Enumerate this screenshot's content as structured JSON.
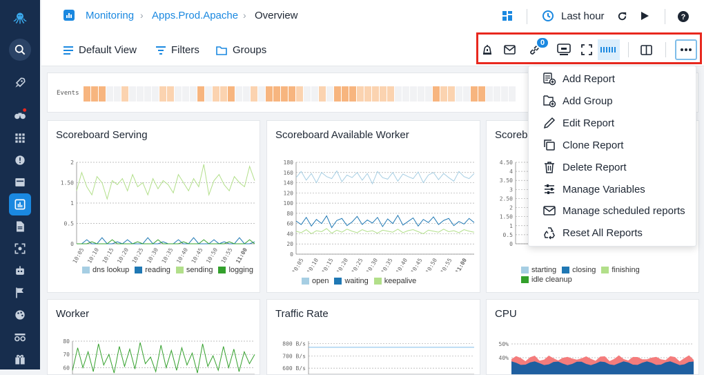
{
  "breadcrumb": {
    "items": [
      "Monitoring",
      "Apps.Prod.Apache",
      "Overview"
    ]
  },
  "time_range": {
    "label": "Last hour"
  },
  "toolbar": {
    "default_view": "Default View",
    "filters": "Filters",
    "groups": "Groups",
    "links_badge": "0"
  },
  "events": {
    "label": "Events"
  },
  "menu": {
    "items": [
      "Add Report",
      "Add Group",
      "Edit Report",
      "Clone Report",
      "Delete Report",
      "Manage Variables",
      "Manage scheduled reports",
      "Reset All Reports"
    ]
  },
  "panels": [
    {
      "title": "Scoreboard Serving",
      "legend": [
        {
          "name": "dns lookup",
          "color": "#a6cee3"
        },
        {
          "name": "reading",
          "color": "#1f78b4"
        },
        {
          "name": "sending",
          "color": "#b2df8a"
        },
        {
          "name": "logging",
          "color": "#33a02c"
        }
      ]
    },
    {
      "title": "Scoreboard Available Worker",
      "legend": [
        {
          "name": "open",
          "color": "#a6cee3"
        },
        {
          "name": "waiting",
          "color": "#1f78b4"
        },
        {
          "name": "keepalive",
          "color": "#b2df8a"
        }
      ]
    },
    {
      "title": "Scoreb",
      "legend": [
        {
          "name": "starting",
          "color": "#a6cee3"
        },
        {
          "name": "closing",
          "color": "#1f78b4"
        },
        {
          "name": "finishing",
          "color": "#b2df8a"
        },
        {
          "name": "idle cleanup",
          "color": "#33a02c"
        }
      ]
    },
    {
      "title": "Worker"
    },
    {
      "title": "Traffic Rate"
    },
    {
      "title": "CPU"
    }
  ],
  "chart_data": [
    {
      "type": "line",
      "title": "Scoreboard Serving",
      "x_ticks": [
        "10:05",
        "10:10",
        "10:15",
        "10:20",
        "10:25",
        "10:30",
        "10:35",
        "10:40",
        "10:45",
        "10:50",
        "10:55",
        "11:00"
      ],
      "y_ticks": [
        "0",
        "0.5",
        "1",
        "1.50",
        "2"
      ],
      "ylim": [
        0,
        2
      ],
      "series": [
        {
          "name": "sending",
          "values": [
            1.3,
            1.75,
            1.4,
            1.2,
            1.65,
            1.5,
            1.1,
            1.55,
            1.45,
            1.6,
            1.3,
            1.7,
            1.4,
            1.5,
            1.2,
            1.6,
            1.35,
            1.55,
            1.45,
            1.25,
            1.7,
            1.5,
            1.3,
            1.6,
            1.4,
            1.95,
            1.2,
            1.55,
            1.7,
            1.45,
            1.3,
            1.65,
            1.5,
            1.4,
            1.9,
            1.55
          ]
        },
        {
          "name": "reading",
          "values": [
            0,
            0,
            0.1,
            0,
            0,
            0.15,
            0,
            0,
            0.05,
            0,
            0.1,
            0,
            0,
            0,
            0.15,
            0,
            0,
            0.05,
            0,
            0,
            0.1,
            0,
            0,
            0.15,
            0,
            0,
            0,
            0.1,
            0,
            0.05,
            0,
            0,
            0.15,
            0,
            0,
            0.05
          ]
        },
        {
          "name": "logging",
          "values": [
            0,
            0,
            0,
            0.05,
            0,
            0,
            0,
            0.1,
            0,
            0,
            0,
            0,
            0.05,
            0,
            0,
            0,
            0.1,
            0,
            0,
            0,
            0,
            0.05,
            0,
            0,
            0,
            0.1,
            0,
            0,
            0,
            0,
            0.05,
            0,
            0,
            0,
            0.1,
            0
          ]
        }
      ]
    },
    {
      "type": "line",
      "title": "Scoreboard Available Worker",
      "x_ticks": [
        "10:05",
        "10:10",
        "10:15",
        "10:20",
        "10:25",
        "10:30",
        "10:35",
        "10:40",
        "10:45",
        "10:50",
        "10:55",
        "11:00"
      ],
      "y_ticks": [
        "0",
        "20",
        "40",
        "60",
        "80",
        "100",
        "120",
        "140",
        "160",
        "180"
      ],
      "ylim": [
        0,
        180
      ],
      "series": [
        {
          "name": "open",
          "values": [
            150,
            162,
            145,
            158,
            140,
            160,
            152,
            148,
            163,
            142,
            155,
            150,
            160,
            145,
            158,
            138,
            162,
            150,
            147,
            160,
            143,
            157,
            152,
            148,
            161,
            140,
            155,
            160,
            146,
            158,
            150,
            143,
            162,
            152,
            148,
            158
          ]
        },
        {
          "name": "waiting",
          "values": [
            65,
            58,
            72,
            55,
            68,
            60,
            75,
            52,
            66,
            70,
            56,
            63,
            74,
            58,
            67,
            61,
            72,
            54,
            69,
            60,
            76,
            57,
            64,
            71,
            55,
            68,
            62,
            73,
            58,
            66,
            70,
            56,
            64,
            59,
            70,
            62
          ]
        },
        {
          "name": "keepalive",
          "values": [
            45,
            42,
            48,
            40,
            46,
            44,
            50,
            41,
            47,
            43,
            49,
            45,
            42,
            48,
            44,
            46,
            41,
            47,
            45,
            43,
            49,
            42,
            46,
            48,
            44,
            40,
            47,
            45,
            43,
            49,
            44,
            46,
            42,
            48,
            45,
            43
          ]
        }
      ]
    },
    {
      "type": "line",
      "title": "Scoreb",
      "y_ticks": [
        "0",
        "0.5",
        "1",
        "1.50",
        "2",
        "2.50",
        "3",
        "3.50",
        "4",
        "4.50"
      ],
      "ylim": [
        0,
        4.5
      ]
    },
    {
      "type": "line",
      "title": "Worker",
      "y_ticks": [
        "60",
        "70",
        "80"
      ],
      "ylim": [
        55,
        80
      ],
      "series": [
        {
          "name": "worker",
          "values": [
            58,
            75,
            60,
            72,
            57,
            78,
            62,
            70,
            56,
            76,
            61,
            74,
            59,
            79,
            63,
            68,
            57,
            77,
            60,
            73,
            58,
            75,
            62,
            71,
            56,
            78,
            61,
            69,
            58,
            76,
            60,
            74,
            57,
            72,
            63,
            70
          ]
        }
      ]
    },
    {
      "type": "line",
      "title": "Traffic Rate",
      "y_ticks": [
        "600 B/s",
        "700 B/s",
        "800 B/s"
      ],
      "ylim": [
        550,
        820
      ],
      "series": [
        {
          "name": "traffic",
          "values": [
            770,
            770,
            770,
            770,
            770,
            770,
            770,
            770,
            770,
            770,
            770,
            770
          ]
        }
      ]
    },
    {
      "type": "area",
      "title": "CPU",
      "y_ticks": [
        "40%",
        "50%"
      ],
      "ylim": [
        28,
        52
      ]
    }
  ]
}
